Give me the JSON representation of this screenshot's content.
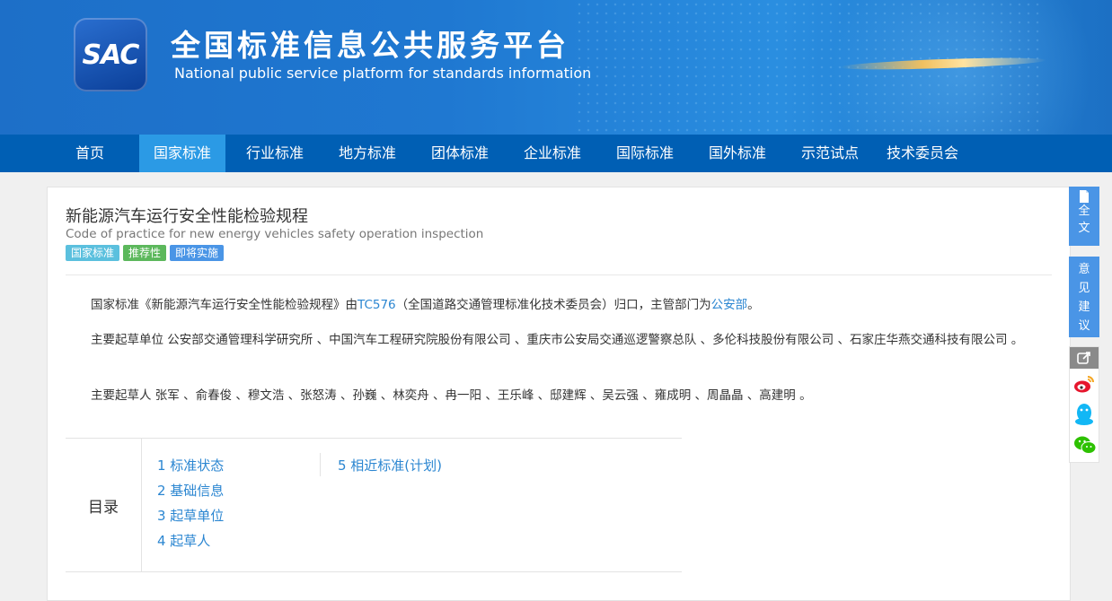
{
  "header": {
    "logo_text": "SAC",
    "title_cn": "全国标准信息公共服务平台",
    "title_en": "National public service platform  for standards information"
  },
  "nav": {
    "items": [
      {
        "label": "首页",
        "active": false
      },
      {
        "label": "国家标准",
        "active": true
      },
      {
        "label": "行业标准",
        "active": false
      },
      {
        "label": "地方标准",
        "active": false
      },
      {
        "label": "团体标准",
        "active": false
      },
      {
        "label": "企业标准",
        "active": false
      },
      {
        "label": "国际标准",
        "active": false
      },
      {
        "label": "国外标准",
        "active": false
      },
      {
        "label": "示范试点",
        "active": false
      },
      {
        "label": "技术委员会",
        "active": false
      }
    ]
  },
  "standard": {
    "title": "新能源汽车运行安全性能检验规程",
    "title_en": "Code of practice for new energy vehicles safety operation inspection",
    "badges": [
      {
        "label": "国家标准",
        "color": "#5bc0de"
      },
      {
        "label": "推荐性",
        "color": "#5cb85c"
      },
      {
        "label": "即将实施",
        "color": "#4a95e6"
      }
    ],
    "desc": {
      "prefix": "国家标准《新能源汽车运行安全性能检验规程》由",
      "tc_link": "TC576",
      "middle": "（全国道路交通管理标准化技术委员会）归口，主管部门为",
      "dept_link": "公安部",
      "suffix": "。"
    },
    "drafting_units": "主要起草单位 公安部交通管理科学研究所 、中国汽车工程研究院股份有限公司 、重庆市公安局交通巡逻警察总队 、多伦科技股份有限公司 、石家庄华燕交通科技有限公司 。",
    "drafters": "主要起草人 张军 、俞春俊 、穆文浩 、张怒涛 、孙巍 、林奕舟 、冉一阳 、王乐峰 、邸建辉 、吴云强 、雍成明 、周晶晶 、高建明 。"
  },
  "toc": {
    "label": "目录",
    "items": [
      "1  标准状态",
      "2  基础信息",
      "3  起草单位",
      "4  起草人",
      "5  相近标准(计划)"
    ]
  },
  "sidebar": {
    "fulltext_label": "全文",
    "feedback_label": "意见建议"
  },
  "colors": {
    "nav_bg": "#005fb4",
    "nav_active": "#2b9ae5",
    "link": "#2b86d1",
    "side_bg": "#4a95e6"
  }
}
